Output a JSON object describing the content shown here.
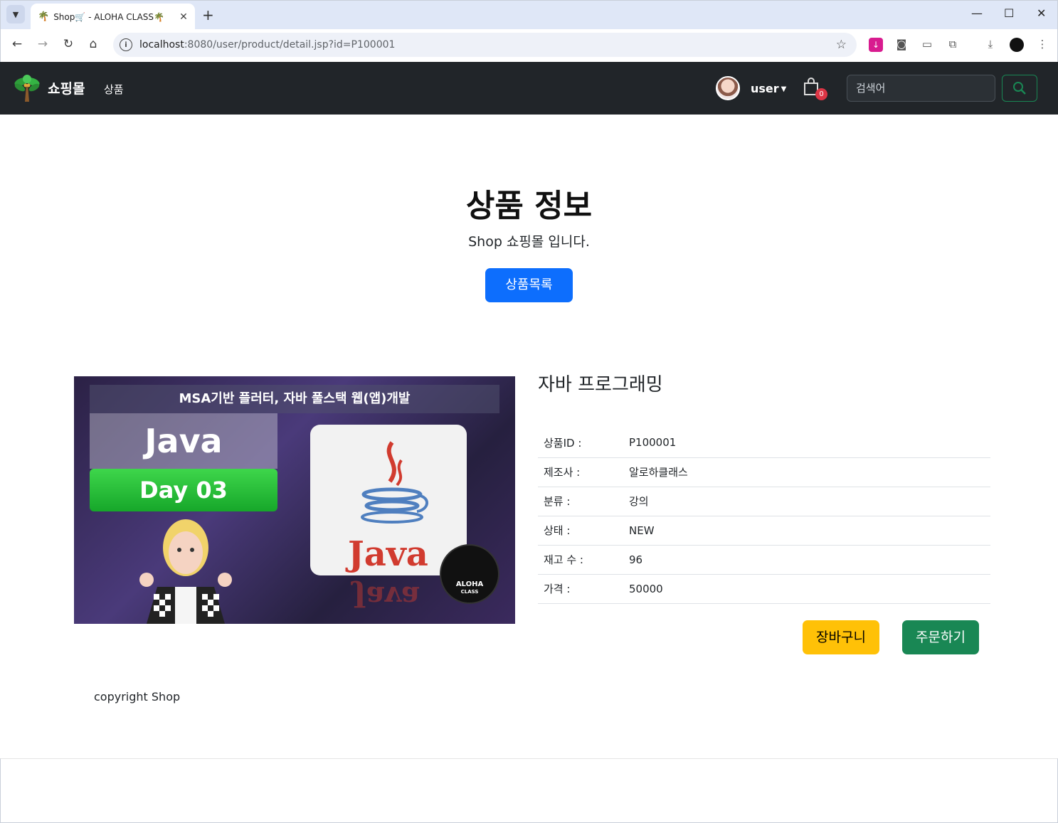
{
  "browser": {
    "tab_title": "Shop🛒 - ALOHA CLASS🌴",
    "tab_favicon": "palm-tree-icon",
    "url_host": "localhost",
    "url_path": ":8080/user/product/detail.jsp?id=P100001"
  },
  "navbar": {
    "brand": "쇼핑몰",
    "link_products": "상품",
    "user_label": "user",
    "cart_count": "0",
    "search_placeholder": "검색어",
    "bg_color": "#212529"
  },
  "hero": {
    "title": "상품 정보",
    "subtitle": "Shop 쇼핑몰 입니다.",
    "list_button": "상품목록"
  },
  "product_image": {
    "banner": "MSA기반 플러터, 자바 풀스택 웹(앱)개발",
    "java_label": "Java",
    "day_label": "Day 03",
    "logo_text": "Java",
    "badge_text": "ALOHA",
    "badge_sub": "CLASS"
  },
  "product": {
    "name": "자바 프로그래밍",
    "rows": [
      {
        "label": "상품ID :",
        "value": "P100001"
      },
      {
        "label": "제조사 :",
        "value": "알로하클래스"
      },
      {
        "label": "분류 :",
        "value": "강의"
      },
      {
        "label": "상태 :",
        "value": "NEW"
      },
      {
        "label": "재고 수 :",
        "value": "96"
      },
      {
        "label": "가격 :",
        "value": "50000"
      }
    ],
    "cart_button": "장바구니",
    "order_button": "주문하기"
  },
  "footer": {
    "text": "copyright Shop"
  },
  "colors": {
    "primary": "#0d6efd",
    "warning": "#ffc107",
    "success": "#198754",
    "danger": "#dc3545"
  }
}
